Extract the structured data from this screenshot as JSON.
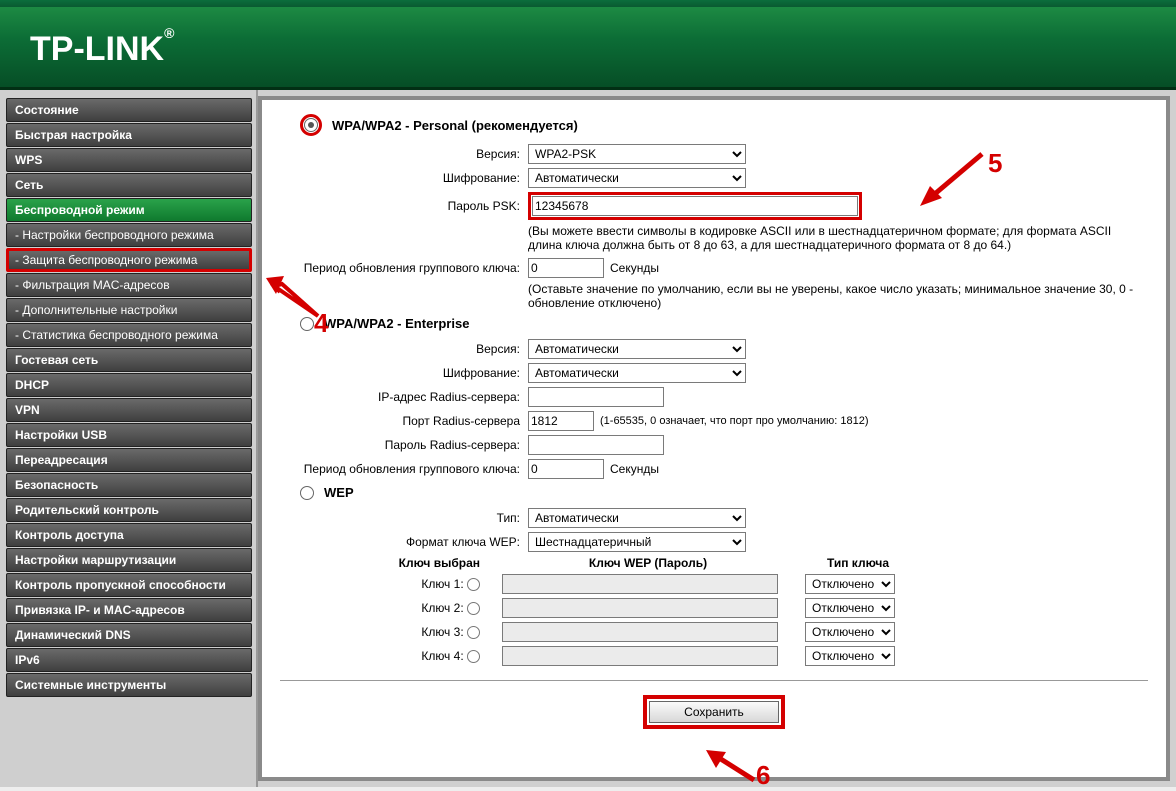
{
  "brand": "TP-LINK",
  "sidebar": {
    "items": [
      {
        "label": "Состояние"
      },
      {
        "label": "Быстрая настройка"
      },
      {
        "label": "WPS"
      },
      {
        "label": "Сеть"
      },
      {
        "label": "Беспроводной режим",
        "active": true
      },
      {
        "label": "- Настройки беспроводного режима",
        "sub": true
      },
      {
        "label": "- Защита беспроводного режима",
        "sub": true,
        "highlight": true
      },
      {
        "label": "- Фильтрация MAC-адресов",
        "sub": true
      },
      {
        "label": "- Дополнительные настройки",
        "sub": true
      },
      {
        "label": "- Статистика беспроводного режима",
        "sub": true
      },
      {
        "label": "Гостевая сеть"
      },
      {
        "label": "DHCP"
      },
      {
        "label": "VPN"
      },
      {
        "label": "Настройки USB"
      },
      {
        "label": "Переадресация"
      },
      {
        "label": "Безопасность"
      },
      {
        "label": "Родительский контроль"
      },
      {
        "label": "Контроль доступа"
      },
      {
        "label": "Настройки маршрутизации"
      },
      {
        "label": "Контроль пропускной способности"
      },
      {
        "label": "Привязка IP- и MAC-адресов"
      },
      {
        "label": "Динамический DNS"
      },
      {
        "label": "IPv6"
      },
      {
        "label": "Системные инструменты"
      }
    ]
  },
  "wpa_personal": {
    "title": "WPA/WPA2 - Personal (рекомендуется)",
    "version_label": "Версия:",
    "version_value": "WPA2-PSK",
    "cipher_label": "Шифрование:",
    "cipher_value": "Автоматически",
    "psk_label": "Пароль PSK:",
    "psk_value": "12345678",
    "psk_hint": "(Вы можете ввести символы в кодировке ASCII или в шестнадцатеричном формате; для формата ASCII длина ключа должна быть от 8 до 63, а для шестнадцатеричного формата от 8 до 64.)",
    "gk_label": "Период обновления группового ключа:",
    "gk_value": "0",
    "gk_unit": "Секунды",
    "gk_hint": "(Оставьте значение по умолчанию, если вы не уверены, какое число указать; минимальное значение 30, 0 - обновление отключено)"
  },
  "wpa_enterprise": {
    "title": "WPA/WPA2 - Enterprise",
    "version_label": "Версия:",
    "version_value": "Автоматически",
    "cipher_label": "Шифрование:",
    "cipher_value": "Автоматически",
    "radius_ip_label": "IP-адрес Radius-сервера:",
    "radius_ip_value": "",
    "radius_port_label": "Порт Radius-сервера",
    "radius_port_value": "1812",
    "radius_port_hint": "(1-65535, 0 означает, что порт про умолчанию: 1812)",
    "radius_pw_label": "Пароль Radius-сервера:",
    "radius_pw_value": "",
    "gk_label": "Период обновления группового ключа:",
    "gk_value": "0",
    "gk_unit": "Секунды"
  },
  "wep": {
    "title": "WEP",
    "type_label": "Тип:",
    "type_value": "Автоматически",
    "format_label": "Формат ключа WEP:",
    "format_value": "Шестнадцатеричный",
    "head_sel": "Ключ выбран",
    "head_key": "Ключ WEP (Пароль)",
    "head_type": "Тип ключа",
    "rows": [
      {
        "label": "Ключ 1:",
        "value": "",
        "type": "Отключено"
      },
      {
        "label": "Ключ 2:",
        "value": "",
        "type": "Отключено"
      },
      {
        "label": "Ключ 3:",
        "value": "",
        "type": "Отключено"
      },
      {
        "label": "Ключ 4:",
        "value": "",
        "type": "Отключено"
      }
    ]
  },
  "save_label": "Сохранить",
  "annotations": {
    "four": "4",
    "five": "5",
    "six": "6"
  }
}
